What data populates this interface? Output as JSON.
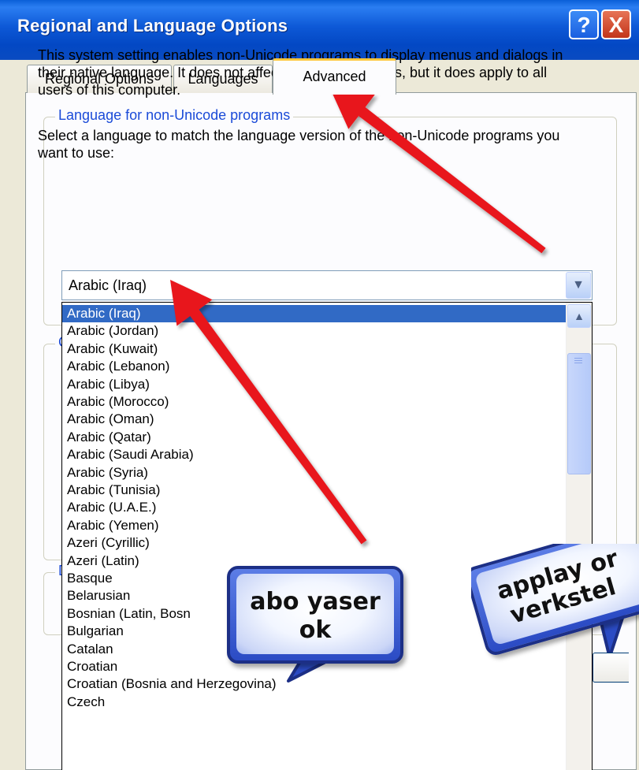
{
  "window": {
    "title": "Regional and Language Options",
    "help_button": "?",
    "close_button": "X"
  },
  "tabs": [
    {
      "label": "Regional Options"
    },
    {
      "label": "Languages"
    },
    {
      "label": "Advanced"
    }
  ],
  "group_non_unicode": {
    "legend": "Language for non-Unicode programs",
    "description": "This system setting enables non-Unicode programs to display menus and dialogs in their native language. It does not affect Unicode programs, but it does apply to all users of this computer.",
    "instruction": "Select a language to match the language version of the non-Unicode programs you want to use:",
    "selected_language": "Arabic (Iraq)"
  },
  "dropdown": {
    "options": [
      "Arabic (Iraq)",
      "Arabic (Jordan)",
      "Arabic (Kuwait)",
      "Arabic (Lebanon)",
      "Arabic (Libya)",
      "Arabic (Morocco)",
      "Arabic (Oman)",
      "Arabic (Qatar)",
      "Arabic (Saudi Arabia)",
      "Arabic (Syria)",
      "Arabic (Tunisia)",
      "Arabic (U.A.E.)",
      "Arabic (Yemen)",
      "Azeri (Cyrillic)",
      "Azeri (Latin)",
      "Basque",
      "Belarusian",
      "Bosnian (Latin, Bosn",
      "Bulgarian",
      "Catalan",
      "Croatian",
      "Croatian (Bosnia and Herzegovina)",
      "Czech"
    ],
    "selected_index": 0
  },
  "hidden_group_letters": {
    "group2": "C",
    "group3": "D"
  },
  "annotations": {
    "bubble_ok": "abo yaser ok",
    "bubble_ok_line1": "abo yaser",
    "bubble_ok_line2": "ok",
    "bubble_apply_line1": "applay or",
    "bubble_apply_line2": "verkstel",
    "arrow_color": "#e8141b"
  }
}
